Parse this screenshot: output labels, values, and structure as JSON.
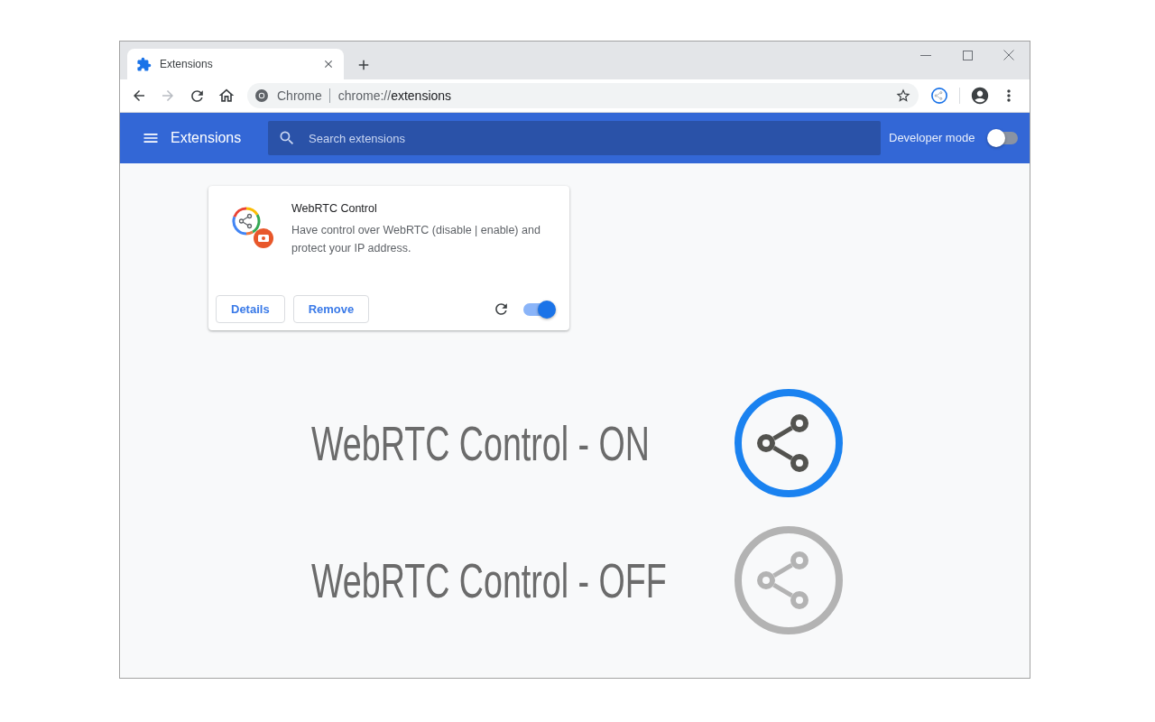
{
  "window": {
    "tabs": [
      {
        "title": "Extensions",
        "selected": true
      }
    ]
  },
  "navigation": {
    "back": {
      "disabled": false
    },
    "forward": {
      "disabled": true
    }
  },
  "address_bar": {
    "site_label": "Chrome",
    "url_scheme": "chrome://",
    "url_path": "extensions"
  },
  "header": {
    "title": "Extensions",
    "search": {
      "placeholder": "Search extensions"
    },
    "developer_mode": {
      "label": "Developer mode",
      "on": false
    }
  },
  "extensions": [
    {
      "name": "WebRTC Control",
      "description": "Have control over WebRTC (disable | enable) and protect your IP address.",
      "buttons": [
        "Details",
        "Remove"
      ],
      "enabled": true
    }
  ],
  "legend": [
    {
      "label": "WebRTC Control - ON",
      "on": true
    },
    {
      "label": "WebRTC Control - OFF",
      "on": false
    }
  ]
}
